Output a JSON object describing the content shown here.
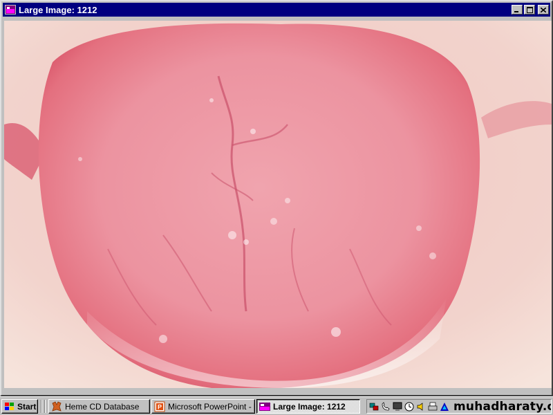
{
  "window": {
    "title": "Large Image: 1212",
    "minimize_icon": "minimize-icon",
    "maximize_icon": "maximize-icon",
    "close_icon": "close-icon"
  },
  "image": {
    "subject": "photograph-icon"
  },
  "taskbar": {
    "start_label": "Start",
    "tasks": [
      {
        "label": "Heme CD Database",
        "icon": "heme-app-icon"
      },
      {
        "label": "Microsoft PowerPoint - [l...",
        "icon": "powerpoint-icon"
      },
      {
        "label": "Large Image: 1212",
        "icon": "image-viewer-icon",
        "active": true
      }
    ],
    "tray": {
      "icons": [
        "network-icon",
        "phone-icon",
        "monitor-icon",
        "scheduler-icon",
        "volume-icon",
        "printer-icon",
        "app-icon"
      ],
      "watermark": "muhadharaty.com"
    }
  }
}
